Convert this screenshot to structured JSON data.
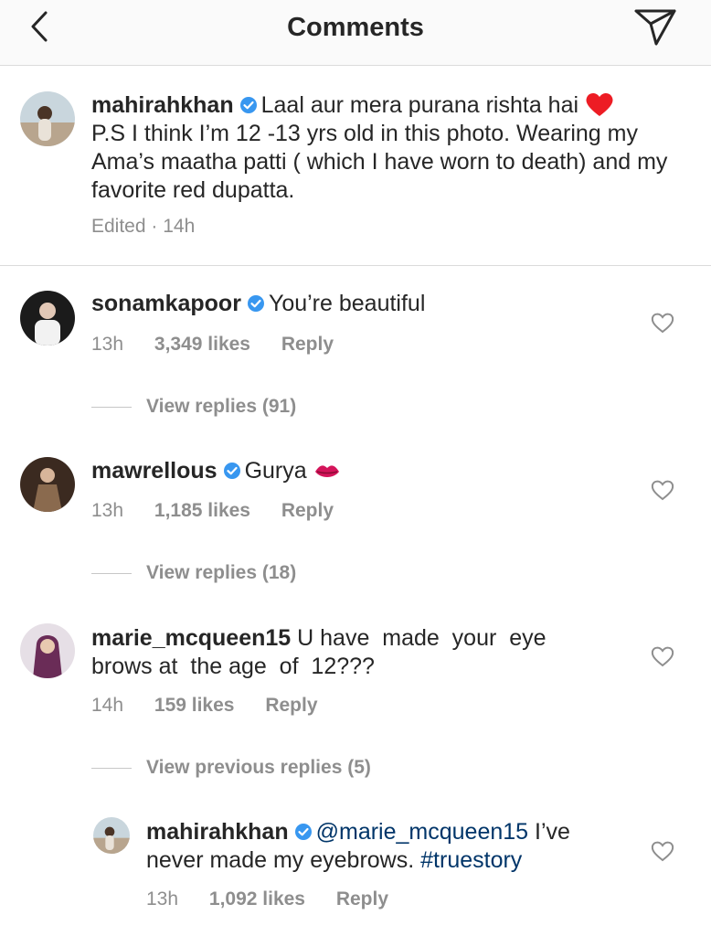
{
  "header": {
    "title": "Comments"
  },
  "caption": {
    "username": "mahirahkhan",
    "text_line1": "Laal aur mera purana rishta hai",
    "text_rest": "P.S I think I’m 12 -13 yrs old in this photo. Wearing my Ama’s maatha patti ( which I have worn to death) and my favorite red dupatta.",
    "meta": "Edited · 14h"
  },
  "comments": [
    {
      "username": "sonamkapoor",
      "text": "You’re beautiful",
      "time": "13h",
      "likes": "3,349 likes",
      "reply": "Reply",
      "view_replies": "View replies (91)"
    },
    {
      "username": "mawrellous",
      "text": "Gurya",
      "time": "13h",
      "likes": "1,185 likes",
      "reply": "Reply",
      "view_replies": "View replies (18)"
    },
    {
      "username": "marie_mcqueen15",
      "text": "U have  made  your  eye brows at  the age  of  12???",
      "time": "14h",
      "likes": "159 likes",
      "reply": "Reply",
      "view_replies": "View previous replies (5)"
    }
  ],
  "reply": {
    "username": "mahirahkhan",
    "mention": "@marie_mcqueen15",
    "text": "I’ve never made my eyebrows.",
    "hashtag": "#truestory",
    "time": "13h",
    "likes": "1,092 likes",
    "reply": "Reply"
  },
  "icons": {
    "back": "chevron-left-icon",
    "send": "paper-plane-icon",
    "verified": "verified-badge-icon",
    "like": "heart-outline-icon"
  },
  "colors": {
    "verified": "#3897f0",
    "link": "#003569",
    "muted": "#8e8e8e",
    "heart_emoji": "#ed1c24"
  }
}
